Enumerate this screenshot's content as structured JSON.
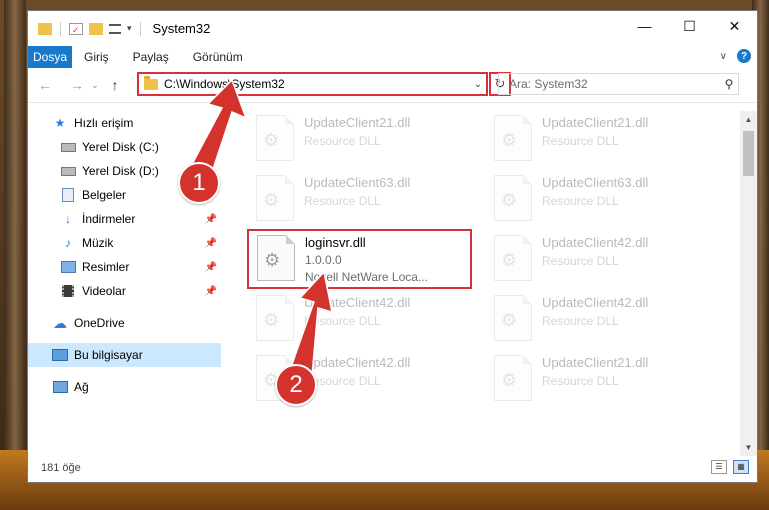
{
  "window": {
    "title": "System32",
    "controls": {
      "minimize": "—",
      "maximize": "☐",
      "close": "✕"
    }
  },
  "ribbon": {
    "tabs": [
      {
        "label": "Dosya"
      },
      {
        "label": "Giriş"
      },
      {
        "label": "Paylaş"
      },
      {
        "label": "Görünüm"
      }
    ],
    "help": "?"
  },
  "navigation": {
    "back": "←",
    "forward": "→",
    "recent": "⌄",
    "up": "↑",
    "address": "C:\\Windows\\System32",
    "refresh": "↻",
    "search_placeholder": "Ara: System32"
  },
  "sidebar": {
    "items": [
      {
        "label": "Hızlı erişim",
        "icon": "star-icon"
      },
      {
        "label": "Yerel Disk (C:)",
        "icon": "drive-icon"
      },
      {
        "label": "Yerel Disk (D:)",
        "icon": "drive-icon"
      },
      {
        "label": "Belgeler",
        "icon": "documents-icon"
      },
      {
        "label": "İndirmeler",
        "icon": "downloads-icon"
      },
      {
        "label": "Müzik",
        "icon": "music-icon"
      },
      {
        "label": "Resimler",
        "icon": "pictures-icon"
      },
      {
        "label": "Videolar",
        "icon": "videos-icon"
      },
      {
        "label": "OneDrive",
        "icon": "cloud-icon"
      },
      {
        "label": "Bu bilgisayar",
        "icon": "computer-icon"
      },
      {
        "label": "Ağ",
        "icon": "network-icon"
      }
    ]
  },
  "files": [
    {
      "name": "UpdateClient21.dll",
      "sub": "Resource DLL"
    },
    {
      "name": "UpdateClient21.dll",
      "sub": "Resource DLL"
    },
    {
      "name": "UpdateClient63.dll",
      "sub": "Resource DLL"
    },
    {
      "name": "UpdateClient63.dll",
      "sub": "Resource DLL"
    },
    {
      "name": "loginsvr.dll",
      "version": "1.0.0.0",
      "sub": "Novell NetWare Loca..."
    },
    {
      "name": "UpdateClient42.dll",
      "sub": "Resource DLL"
    },
    {
      "name": "UpdateClient42.dll",
      "sub": "Resource DLL"
    },
    {
      "name": "UpdateClient42.dll",
      "sub": "Resource DLL"
    },
    {
      "name": "UpdateClient42.dll",
      "sub": "Resource DLL"
    },
    {
      "name": "UpdateClient21.dll",
      "sub": "Resource DLL"
    }
  ],
  "status": {
    "count": "181 öğe"
  },
  "callouts": {
    "one": "1",
    "two": "2"
  },
  "colors": {
    "accent": "#1979ca",
    "highlight": "#d9313a",
    "selected": "#cce8ff"
  }
}
